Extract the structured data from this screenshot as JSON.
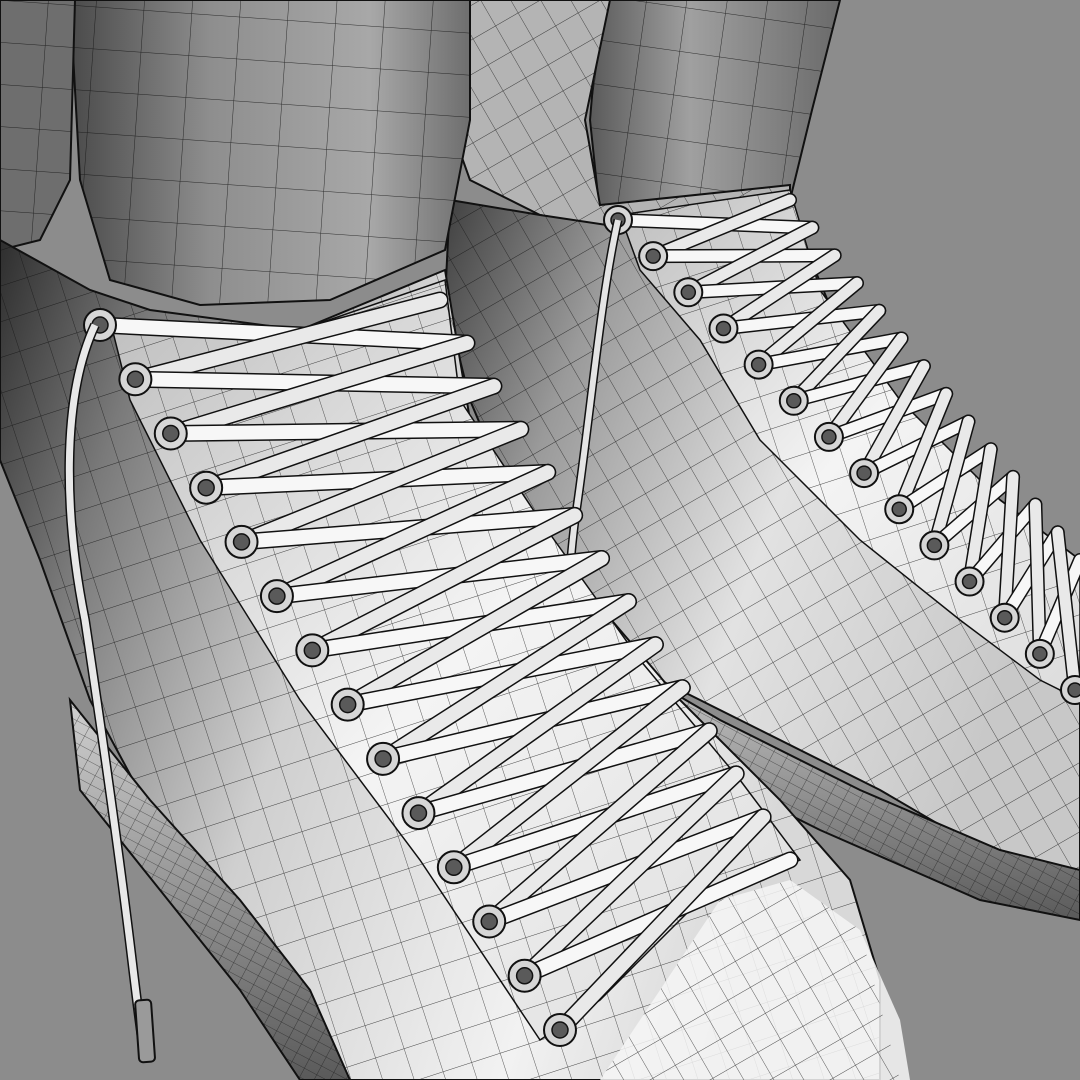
{
  "scene": {
    "subject": "wireframe-render",
    "colors": {
      "background": "#8c8c8c",
      "shade_dark": "#3c3c3c",
      "shade_mid": "#a6a6a6",
      "shade_light": "#eeeeee",
      "wire": "#1a1a1a"
    },
    "icons": [
      "skate-boot-left",
      "skate-boot-right",
      "lace",
      "eyelet"
    ]
  }
}
